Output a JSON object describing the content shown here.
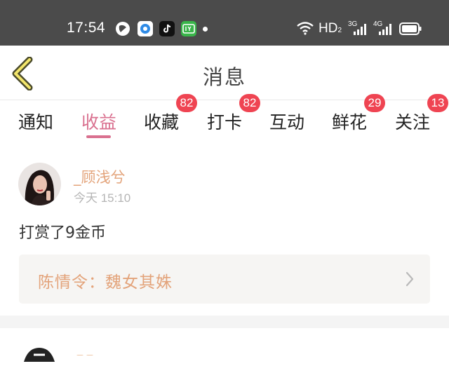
{
  "status_bar": {
    "time": "17:54",
    "icons": [
      "app-icon-dark-circle",
      "app-icon-blue",
      "tiktok-icon",
      "iqiyi-icon",
      "dot-icon"
    ],
    "system": {
      "hd": "HD",
      "hd_sub": "2",
      "net1": "3G",
      "net2": "4G"
    }
  },
  "nav": {
    "title": "消息"
  },
  "tabs": [
    {
      "label": "通知"
    },
    {
      "label": "收益",
      "active": true
    },
    {
      "label": "收藏",
      "badge": "82"
    },
    {
      "label": "打卡",
      "badge": "82"
    },
    {
      "label": "互动"
    },
    {
      "label": "鲜花",
      "badge": "29"
    },
    {
      "label": "关注",
      "badge": "13"
    }
  ],
  "item": {
    "user_name": "_顾浅兮",
    "time": "今天 15:10",
    "message": "打赏了9金币",
    "ref_title": "陈情令：魏女其姝"
  },
  "colors": {
    "accent": "#d9708f",
    "badge": "#ef4452",
    "name": "#e3a37a",
    "status_bar": "#4b4b4b"
  }
}
